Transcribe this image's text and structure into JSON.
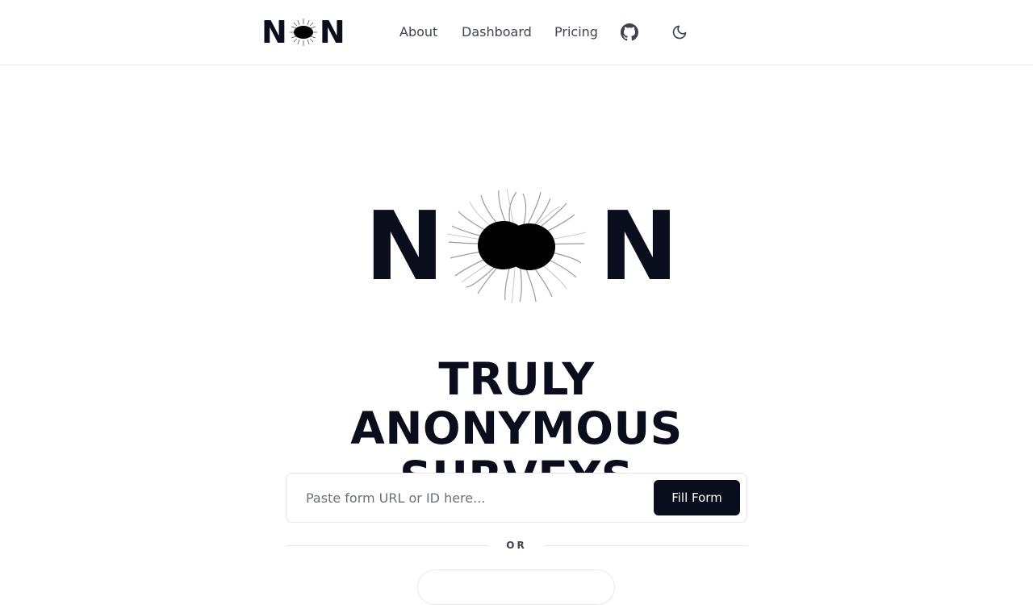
{
  "header": {
    "logo": {
      "letter_left": "N",
      "letter_right": "N"
    },
    "nav": [
      {
        "label": "About"
      },
      {
        "label": "Dashboard"
      },
      {
        "label": "Pricing"
      }
    ],
    "icons": {
      "github": "github-icon",
      "theme": "moon-icon"
    }
  },
  "hero": {
    "logo": {
      "letter_left": "N",
      "letter_right": "N"
    },
    "headline_line1": "TRULY ANONYMOUS",
    "headline_line2": "SURVEYS"
  },
  "form": {
    "placeholder": "Paste form URL or ID here...",
    "value": "",
    "button_label": "Fill Form"
  },
  "divider": {
    "label": "OR"
  },
  "colors": {
    "ink": "#0a0e1c",
    "muted": "#3f4350",
    "border": "#e5e7eb"
  }
}
